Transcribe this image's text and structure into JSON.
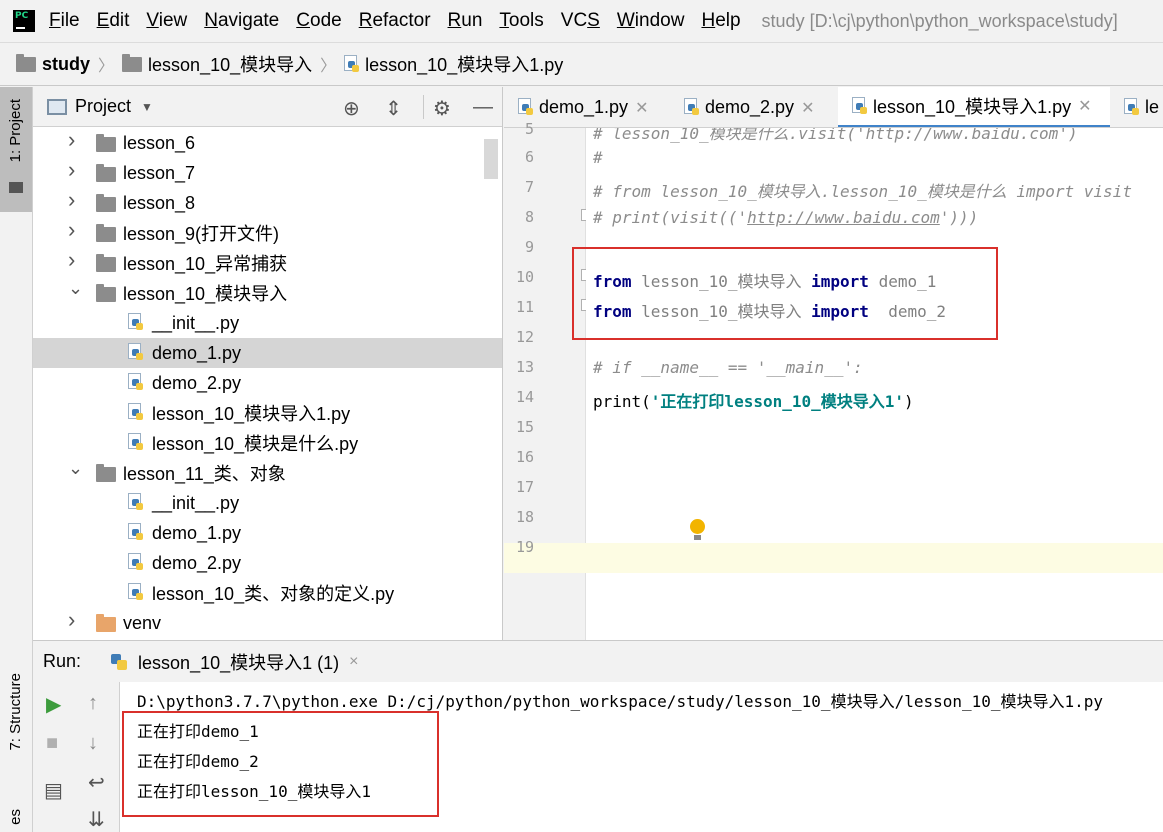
{
  "menubar": {
    "items": [
      {
        "mnemonic": "F",
        "rest": "ile"
      },
      {
        "mnemonic": "E",
        "rest": "dit"
      },
      {
        "mnemonic": "V",
        "rest": "iew"
      },
      {
        "mnemonic": "N",
        "rest": "avigate"
      },
      {
        "mnemonic": "C",
        "rest": "ode"
      },
      {
        "mnemonic": "R",
        "rest": "efactor"
      },
      {
        "mnemonic": "R",
        "rest": "un"
      },
      {
        "mnemonic": "T",
        "rest": "ools"
      },
      {
        "pre": "VC",
        "mnemonic": "S",
        "rest": ""
      },
      {
        "mnemonic": "W",
        "rest": "indow"
      },
      {
        "mnemonic": "H",
        "rest": "elp"
      }
    ],
    "window_title": "study [D:\\cj\\python\\python_workspace\\study]"
  },
  "breadcrumb": [
    "study",
    "lesson_10_模块导入",
    "lesson_10_模块导入1.py"
  ],
  "left_strip": {
    "project_tool": "1: Project",
    "structure_tool": "7: Structure",
    "bottom_cut": "es"
  },
  "project_panel": {
    "title": "Project",
    "tree": [
      {
        "label": "lesson_6",
        "type": "folder",
        "depth": 0,
        "expanded": false
      },
      {
        "label": "lesson_7",
        "type": "folder",
        "depth": 0,
        "expanded": false
      },
      {
        "label": "lesson_8",
        "type": "folder",
        "depth": 0,
        "expanded": false
      },
      {
        "label": "lesson_9(打开文件)",
        "type": "folder",
        "depth": 0,
        "expanded": false
      },
      {
        "label": "lesson_10_异常捕获",
        "type": "folder",
        "depth": 0,
        "expanded": false
      },
      {
        "label": "lesson_10_模块导入",
        "type": "folder",
        "depth": 0,
        "expanded": true
      },
      {
        "label": "__init__.py",
        "type": "file",
        "depth": 1
      },
      {
        "label": "demo_1.py",
        "type": "file",
        "depth": 1,
        "selected": true
      },
      {
        "label": "demo_2.py",
        "type": "file",
        "depth": 1
      },
      {
        "label": "lesson_10_模块导入1.py",
        "type": "file",
        "depth": 1
      },
      {
        "label": "lesson_10_模块是什么.py",
        "type": "file",
        "depth": 1
      },
      {
        "label": "lesson_11_类、对象",
        "type": "folder",
        "depth": 0,
        "expanded": true
      },
      {
        "label": "__init__.py",
        "type": "file",
        "depth": 1
      },
      {
        "label": "demo_1.py",
        "type": "file",
        "depth": 1
      },
      {
        "label": "demo_2.py",
        "type": "file",
        "depth": 1
      },
      {
        "label": "lesson_10_类、对象的定义.py",
        "type": "file",
        "depth": 1
      },
      {
        "label": "venv",
        "type": "venv",
        "depth": 0,
        "expanded": false
      }
    ]
  },
  "editor": {
    "tabs": [
      {
        "label": "demo_1.py",
        "active": false
      },
      {
        "label": "demo_2.py",
        "active": false
      },
      {
        "label": "lesson_10_模块导入1.py",
        "active": true
      },
      {
        "label": "le",
        "active": false
      }
    ],
    "line_numbers": [
      "5",
      "6",
      "7",
      "8",
      "9",
      "10",
      "11",
      "12",
      "13",
      "14",
      "15",
      "16",
      "17",
      "18",
      "19"
    ],
    "lines": {
      "l5": "# lesson_10_模块是什么.visit('http://www.baidu.com')",
      "l6": "#",
      "l7": "# from lesson_10_模块导入.lesson_10_模块是什么 import visit",
      "l8_pre": "# print(visit(('",
      "l8_url": "http://www.baidu.com",
      "l8_post": "')))",
      "l10_from": "from",
      "l10_mod": " lesson_10_模块导入 ",
      "l10_import": "import",
      "l10_name": " demo_1",
      "l11_from": "from",
      "l11_mod": " lesson_10_模块导入 ",
      "l11_import": "import",
      "l11_name": "  demo_2",
      "l13": "# if __name__ == '__main__':",
      "l14_fn": "print(",
      "l14_str": "'正在打印lesson_10_模块导入1'",
      "l14_end": ")"
    }
  },
  "run": {
    "label": "Run:",
    "tab": "lesson_10_模块导入1 (1)",
    "close": "×",
    "console": [
      "D:\\python3.7.7\\python.exe D:/cj/python/python_workspace/study/lesson_10_模块导入/lesson_10_模块导入1.py",
      "正在打印demo_1",
      "正在打印demo_2",
      "正在打印lesson_10_模块导入1"
    ]
  },
  "colors": {
    "accent": "#4083c9",
    "highlight_box": "#d9302b",
    "keyword": "#000080",
    "string": "#008080",
    "comment": "#8c8c8c",
    "run_green": "#3d9c3d"
  }
}
